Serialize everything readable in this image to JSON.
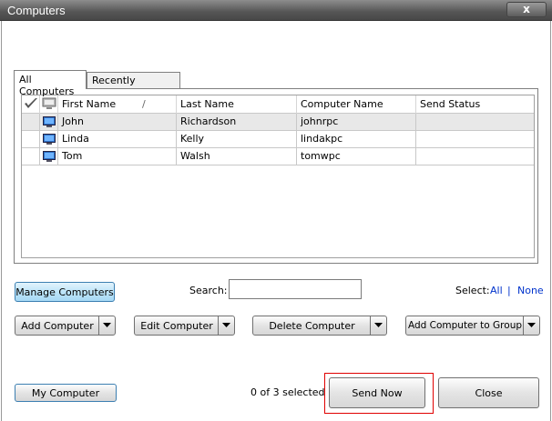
{
  "window": {
    "title": "Computers",
    "close_glyph": "x"
  },
  "tabs": [
    {
      "label": "All Computers",
      "active": true
    },
    {
      "label": "Recently Accessed",
      "active": false
    }
  ],
  "grid": {
    "columns": [
      "First Name",
      "Last Name",
      "Computer Name",
      "Send Status"
    ],
    "sort_glyph": "/",
    "rows": [
      {
        "first": "John",
        "last": "Richardson",
        "computer": "johnrpc",
        "status": ""
      },
      {
        "first": "Linda",
        "last": "Kelly",
        "computer": "lindakpc",
        "status": ""
      },
      {
        "first": "Tom",
        "last": "Walsh",
        "computer": "tomwpc",
        "status": ""
      }
    ]
  },
  "toolbar": {
    "manage_computers": "Manage Computers",
    "search_label": "Search:",
    "search_value": "",
    "select_label": "Select:",
    "select_all": "All",
    "select_sep": "|",
    "select_none": "None"
  },
  "actions": {
    "add_computer": "Add Computer",
    "edit_computer": "Edit Computer",
    "delete_computer": "Delete Computer",
    "add_to_group": "Add Computer to Group"
  },
  "footer": {
    "my_computer": "My Computer",
    "selected_count": "0 of 3 selected",
    "send_now": "Send Now",
    "close": "Close"
  },
  "colors": {
    "accent_blue_button": "#bee5f9",
    "link": "#0033cc",
    "highlight_border": "#e00000"
  }
}
